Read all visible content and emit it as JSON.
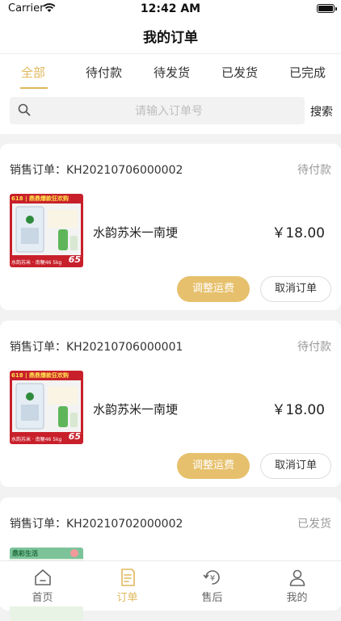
{
  "status_bar": {
    "carrier": "Carrier",
    "time": "12:42 AM"
  },
  "header": {
    "title": "我的订单"
  },
  "tabs": [
    {
      "label": "全部",
      "active": true
    },
    {
      "label": "待付款"
    },
    {
      "label": "待发货"
    },
    {
      "label": "已发货"
    },
    {
      "label": "已完成"
    }
  ],
  "search": {
    "placeholder": "请输入订单号",
    "button_label": "搜索"
  },
  "orders": [
    {
      "header": "销售订单：KH20210706000002",
      "status": "待付款",
      "product_name": "水韵苏米一南埂",
      "price": "￥18.00",
      "adjust_label": "调整运费",
      "cancel_label": "取消订单",
      "thumb_banner": "618 | 鼎鼎爆款狂欢购",
      "thumb_caption": "水韵苏米 · 南粳46 5kg",
      "thumb_price": "65"
    },
    {
      "header": "销售订单：KH20210706000001",
      "status": "待付款",
      "product_name": "水韵苏米一南埂",
      "price": "￥18.00",
      "adjust_label": "调整运费",
      "cancel_label": "取消订单",
      "thumb_banner": "618 | 鼎鼎爆款狂欢购",
      "thumb_caption": "水韵苏米 · 南粳46 5kg",
      "thumb_price": "65"
    },
    {
      "header": "销售订单：KH20210702000002",
      "status": "已发货",
      "thumb_banner": "鼎彩生活"
    }
  ],
  "tab_bar": [
    {
      "label": "首页",
      "icon": "home-icon"
    },
    {
      "label": "订单",
      "icon": "order-icon",
      "active": true
    },
    {
      "label": "售后",
      "icon": "after-sales-icon"
    },
    {
      "label": "我的",
      "icon": "profile-icon"
    }
  ],
  "colors": {
    "accent": "#e0b85c",
    "button": "#e6c06c",
    "thumb_red": "#c8202b"
  }
}
